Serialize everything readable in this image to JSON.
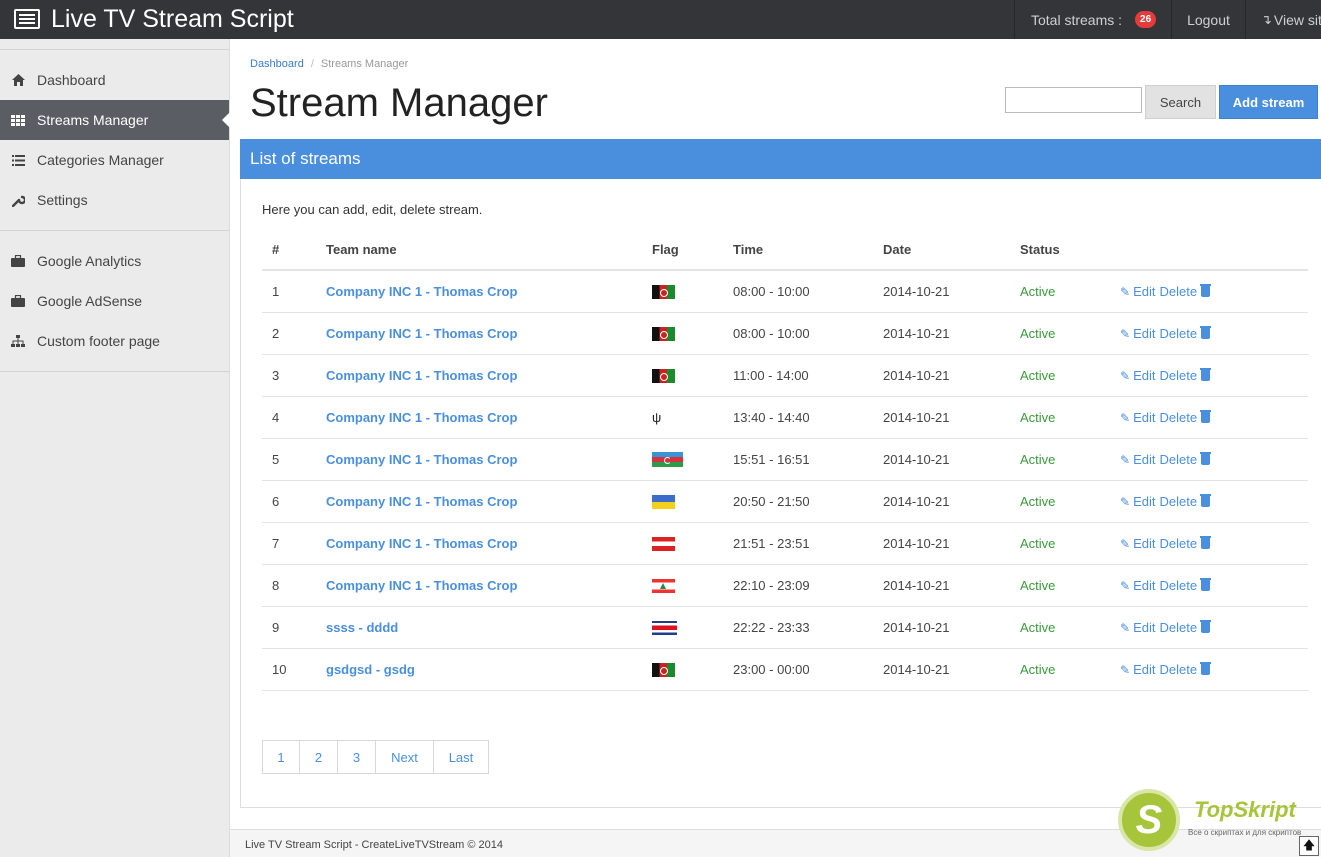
{
  "app": {
    "title": "Live TV Stream Script"
  },
  "topnav": {
    "total_label": "Total streams :",
    "total_count": "26",
    "logout": "Logout",
    "view_site": "View site"
  },
  "sidebar": {
    "items": [
      {
        "label": "Dashboard",
        "icon": "home-icon"
      },
      {
        "label": "Streams Manager",
        "icon": "grid-icon",
        "active": true
      },
      {
        "label": "Categories Manager",
        "icon": "list-icon"
      },
      {
        "label": "Settings",
        "icon": "wrench-icon"
      },
      {
        "label": "Google Analytics",
        "icon": "briefcase-icon"
      },
      {
        "label": "Google AdSense",
        "icon": "briefcase-icon"
      },
      {
        "label": "Custom footer page",
        "icon": "sitemap-icon"
      }
    ]
  },
  "breadcrumb": {
    "home": "Dashboard",
    "divider": "/",
    "current": "Streams Manager"
  },
  "page": {
    "title": "Stream Manager",
    "search_button": "Search",
    "add_button": "Add stream",
    "panel_title": "List of streams",
    "intro": "Here you can add, edit, delete stream."
  },
  "table": {
    "headers": [
      "#",
      "Team name",
      "Flag",
      "Time",
      "Date",
      "Status",
      ""
    ],
    "edit_label": "Edit",
    "delete_label": "Delete",
    "rows": [
      {
        "num": "1",
        "team": "Company INC 1 - Thomas Crop",
        "flag": "af",
        "time": "08:00 - 10:00",
        "date": "2014-10-21",
        "status": "Active"
      },
      {
        "num": "2",
        "team": "Company INC 1 - Thomas Crop",
        "flag": "af",
        "time": "08:00 - 10:00",
        "date": "2014-10-21",
        "status": "Active"
      },
      {
        "num": "3",
        "team": "Company INC 1 - Thomas Crop",
        "flag": "af",
        "time": "11:00 - 14:00",
        "date": "2014-10-21",
        "status": "Active"
      },
      {
        "num": "4",
        "team": "Company INC 1 - Thomas Crop",
        "flag": "sym",
        "time": "13:40 - 14:40",
        "date": "2014-10-21",
        "status": "Active"
      },
      {
        "num": "5",
        "team": "Company INC 1 - Thomas Crop",
        "flag": "az",
        "time": "15:51 - 16:51",
        "date": "2014-10-21",
        "status": "Active"
      },
      {
        "num": "6",
        "team": "Company INC 1 - Thomas Crop",
        "flag": "ua",
        "time": "20:50 - 21:50",
        "date": "2014-10-21",
        "status": "Active"
      },
      {
        "num": "7",
        "team": "Company INC 1 - Thomas Crop",
        "flag": "at",
        "time": "21:51 - 23:51",
        "date": "2014-10-21",
        "status": "Active"
      },
      {
        "num": "8",
        "team": "Company INC 1 - Thomas Crop",
        "flag": "lb",
        "time": "22:10 - 23:09",
        "date": "2014-10-21",
        "status": "Active"
      },
      {
        "num": "9",
        "team": "ssss - dddd",
        "flag": "cr",
        "time": "22:22 - 23:33",
        "date": "2014-10-21",
        "status": "Active"
      },
      {
        "num": "10",
        "team": "gsdgsd - gsdg",
        "flag": "af",
        "time": "23:00 - 00:00",
        "date": "2014-10-21",
        "status": "Active"
      }
    ]
  },
  "pagination": [
    "1",
    "2",
    "3",
    "Next",
    "Last"
  ],
  "footer": {
    "text": "Live TV Stream Script - CreateLiveTVStream © 2014"
  },
  "watermark": {
    "title": "TopSkript",
    "subtitle": "Все о скриптах и для скриптов",
    "letter": "S"
  },
  "colors": {
    "accent": "#4a8fde",
    "topbar": "#333538",
    "status_active": "#3a9a3a",
    "badge": "#e43c3c"
  }
}
